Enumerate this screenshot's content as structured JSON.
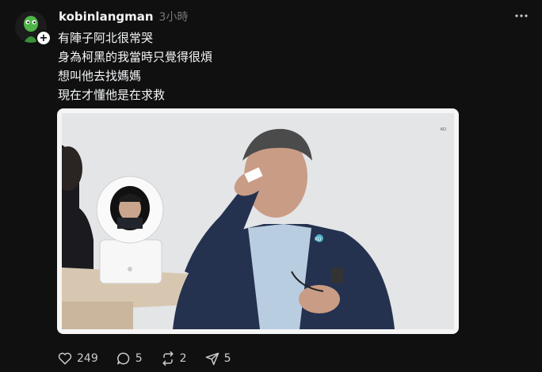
{
  "post": {
    "username": "kobinlangman",
    "time": "3小時",
    "lines": [
      "有陣子阿北很常哭",
      "身為柯黑的我當時只覺得很煩",
      "想叫他去找媽媽",
      "現在才懂他是在求救"
    ],
    "image_watermark": "KO",
    "stats": {
      "likes": "249",
      "comments": "5",
      "reposts": "2",
      "shares": "5"
    }
  },
  "icons": {
    "follow": "plus-icon",
    "more": "more-horizontal-icon",
    "like": "heart-icon",
    "comment": "comment-icon",
    "repost": "repost-icon",
    "share": "send-icon"
  },
  "colors": {
    "background": "#101010",
    "text": "#f3f5f7",
    "muted": "#777777"
  }
}
